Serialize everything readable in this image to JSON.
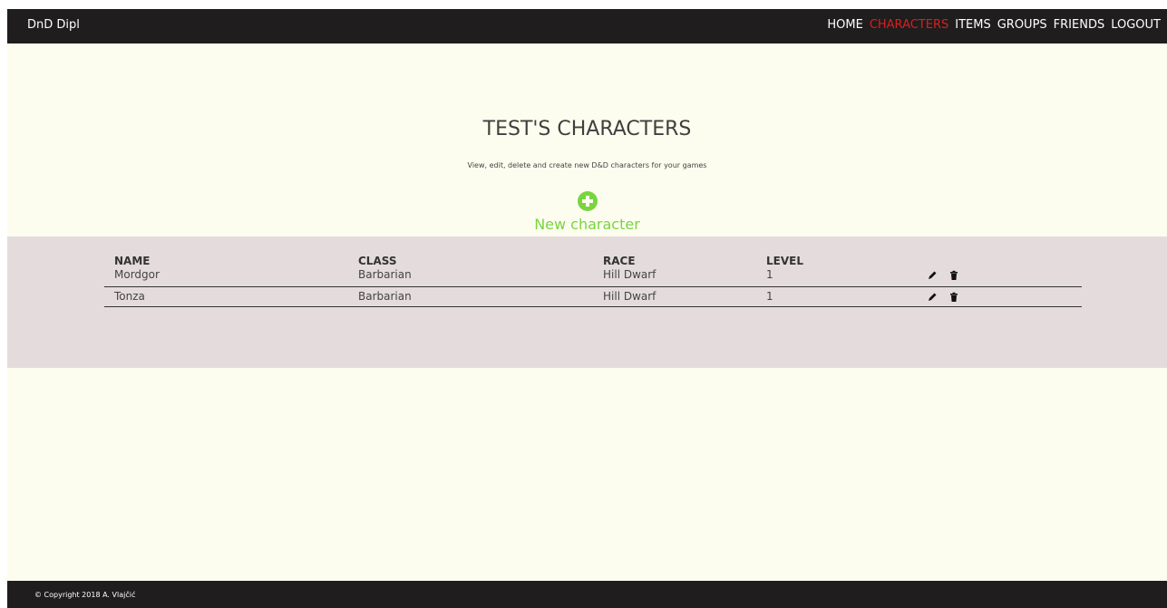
{
  "navbar": {
    "brand": "DnD Dipl",
    "items": [
      {
        "label": "HOME",
        "active": false
      },
      {
        "label": "CHARACTERS",
        "active": true
      },
      {
        "label": "ITEMS",
        "active": false
      },
      {
        "label": "GROUPS",
        "active": false
      },
      {
        "label": "FRIENDS",
        "active": false
      },
      {
        "label": "LOGOUT",
        "active": false
      }
    ]
  },
  "page": {
    "title": "TEST'S CHARACTERS",
    "subtitle": "View, edit, delete and create new D&D characters for your games",
    "new_button": {
      "icon": "plus-circle-icon",
      "label": "New character"
    }
  },
  "table": {
    "headers": {
      "name": "NAME",
      "class": "CLASS",
      "race": "RACE",
      "level": "LEVEL"
    },
    "rows": [
      {
        "name": "Mordgor",
        "class": "Barbarian",
        "race": "Hill Dwarf",
        "level": "1"
      },
      {
        "name": "Tonza",
        "class": "Barbarian",
        "race": "Hill Dwarf",
        "level": "1"
      }
    ],
    "action_icons": [
      "pencil-icon",
      "trash-icon"
    ]
  },
  "footer": {
    "copyright": "© Copyright 2018 A. Vlajčić"
  },
  "colors": {
    "navbar": "#1f1d1d",
    "page": "#fdfdef",
    "band": "#e4dcdc",
    "accent_green": "#7ad43f",
    "active_nav": "#d91f1f"
  }
}
